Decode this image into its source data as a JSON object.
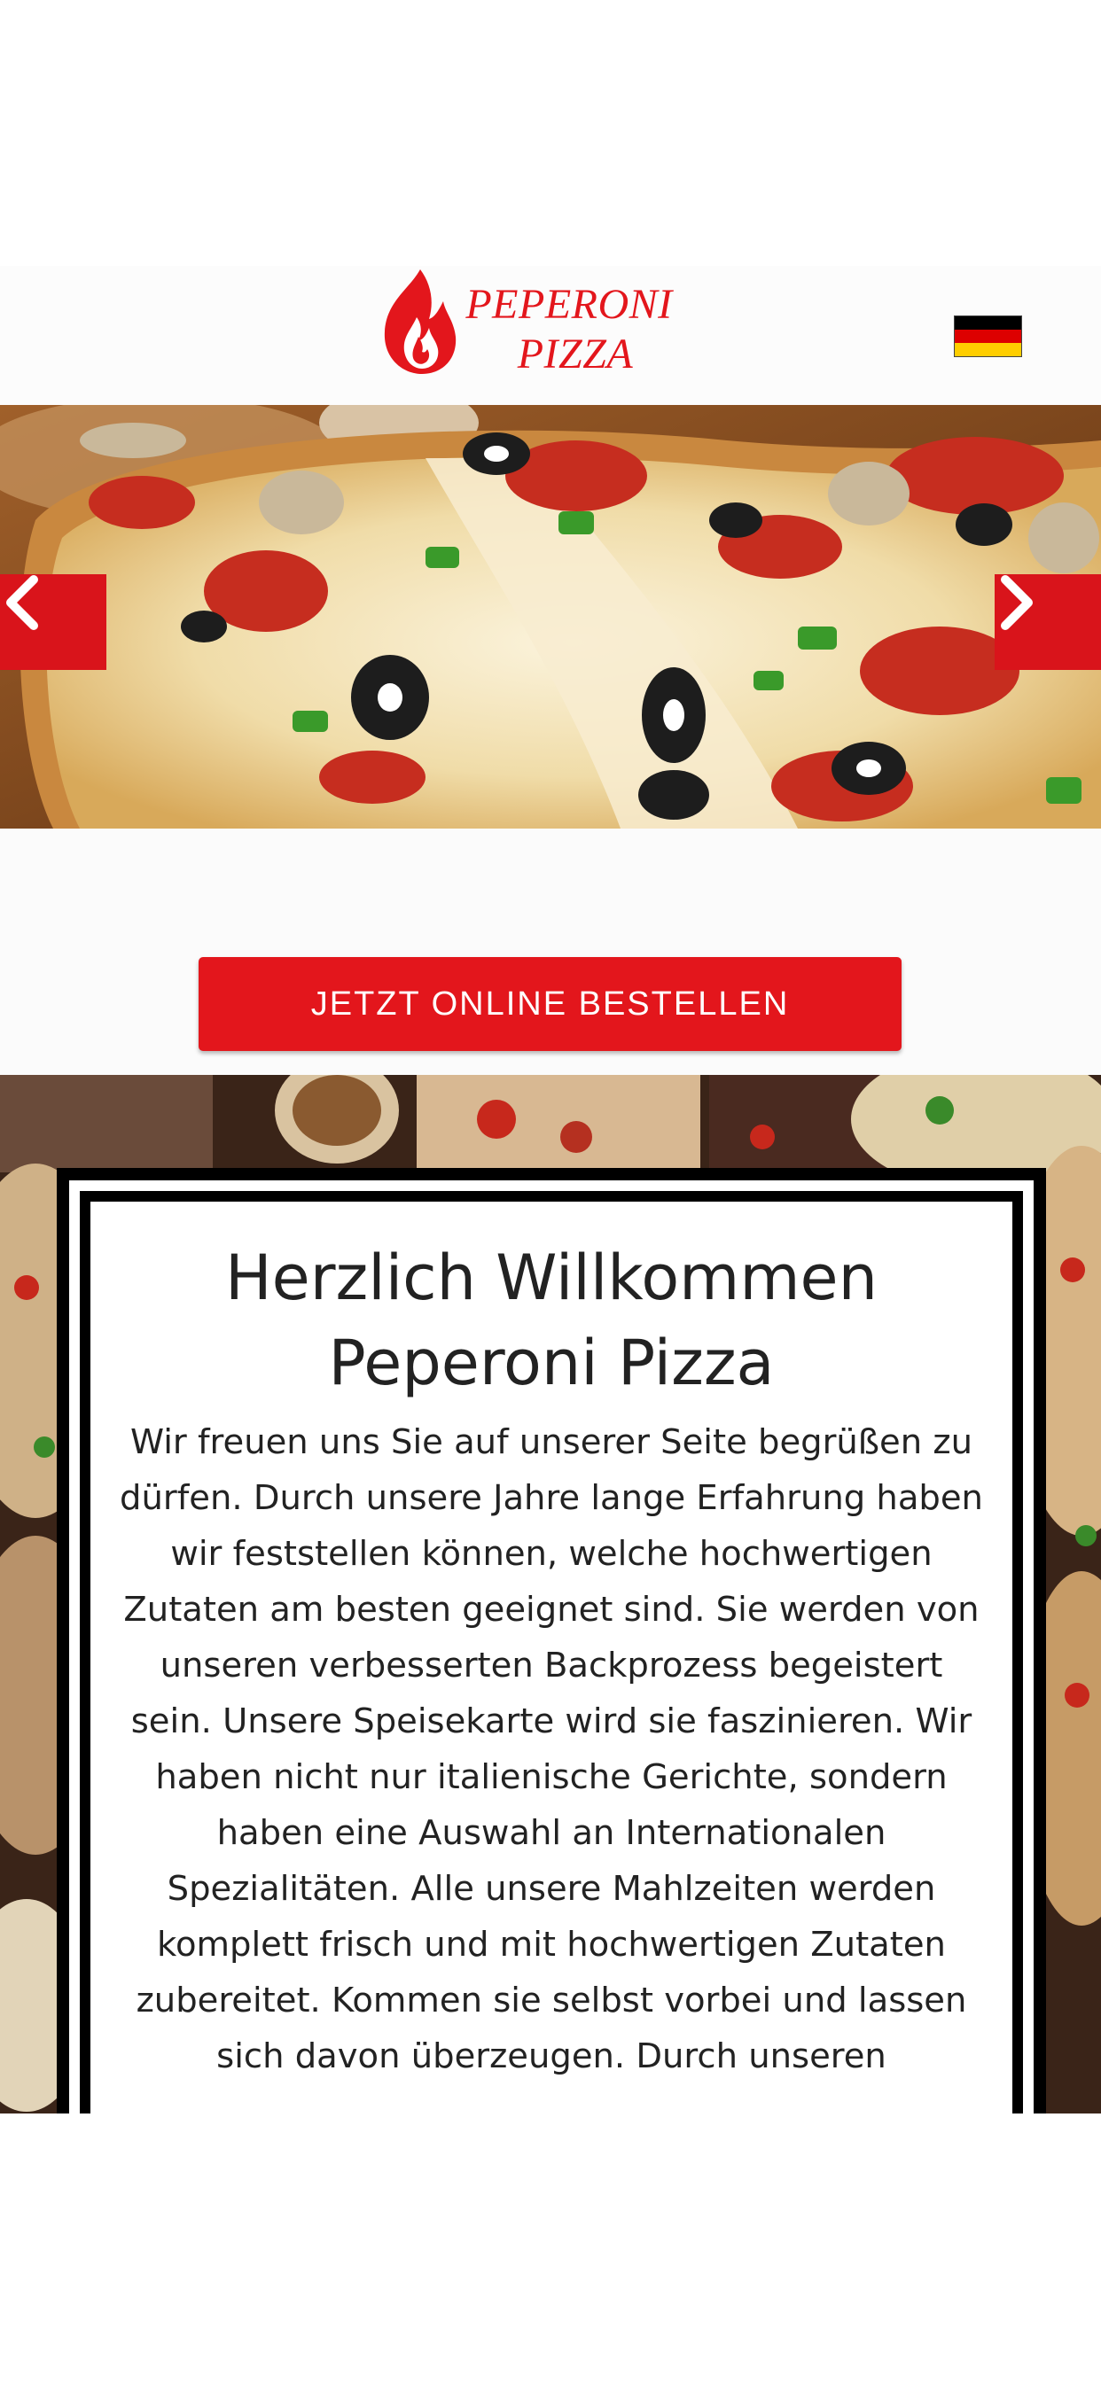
{
  "brand": {
    "name_line1": "PEPERONI",
    "name_line2": "PIZZA",
    "accent_color": "#e3161c",
    "logo_icon": "flame-icon"
  },
  "header": {
    "language_flag": "germany-flag-icon"
  },
  "slider": {
    "prev_icon": "chevron-left-icon",
    "next_icon": "chevron-right-icon",
    "image": "pizza-photo"
  },
  "order": {
    "button_label": "JETZT ONLINE BESTELLEN"
  },
  "welcome": {
    "title": "Herzlich Willkommen Peperoni Pizza",
    "text": "Wir freuen uns Sie auf unserer Seite begrüßen zu dürfen. Durch unsere Jahre lange Erfahrung haben wir feststellen können, welche hochwertigen Zutaten am besten geeignet sind. Sie werden von unseren verbesserten Backprozess begeistert sein. Unsere Speisekarte wird sie faszinieren. Wir haben nicht nur italienische Gerichte, sondern haben eine Auswahl an Internationalen Spezialitäten. Alle unsere Mahlzeiten werden komplett frisch und mit hochwertigen Zutaten zubereitet. Kommen sie selbst vorbei und lassen sich davon überzeugen. Durch unseren"
  }
}
